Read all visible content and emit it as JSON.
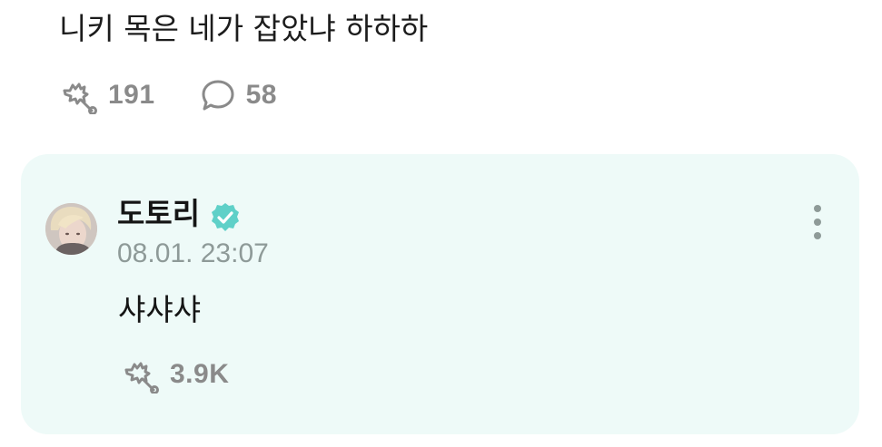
{
  "post": {
    "text": "니키 목은 네가 잡았냐 하하하",
    "like_icon": "like-hand-icon",
    "like_count": "191",
    "comment_icon": "comment-bubble-icon",
    "comment_count": "58"
  },
  "reply": {
    "author": "도토리",
    "verified_icon": "verified-badge-icon",
    "verified_color": "#5fd0c8",
    "timestamp": "08.01. 23:07",
    "text": "샤샤샤",
    "like_count": "3.9K",
    "more_icon": "more-vertical-icon",
    "card_background": "#eefaf8"
  }
}
